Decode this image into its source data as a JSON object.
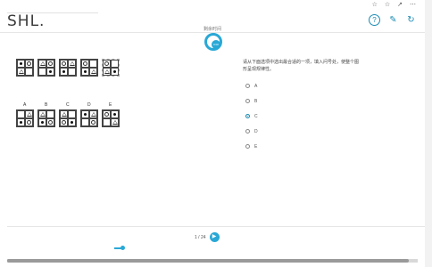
{
  "header": {
    "logo": "SHL.",
    "browser_icons": [
      "☆",
      "☆",
      "↗",
      "⋯"
    ],
    "help_label": "?",
    "settings_label": "✎",
    "refresh_label": "↻"
  },
  "timer": {
    "label": "剩余时间",
    "value": "0:00"
  },
  "question": {
    "text": "请从下面选项中选出最合适的一项，填入问号处，使整个图形呈现规律性。",
    "options": [
      {
        "label": "A",
        "selected": false
      },
      {
        "label": "B",
        "selected": false
      },
      {
        "label": "C",
        "selected": true
      },
      {
        "label": "D",
        "selected": false
      },
      {
        "label": "E",
        "selected": false
      }
    ]
  },
  "option_labels": [
    "A",
    "B",
    "C",
    "D",
    "E"
  ],
  "pager": {
    "text": "1 / 24",
    "prev_label": "<",
    "current": "1",
    "total": "24"
  },
  "colors": {
    "accent": "#29a8d6"
  }
}
